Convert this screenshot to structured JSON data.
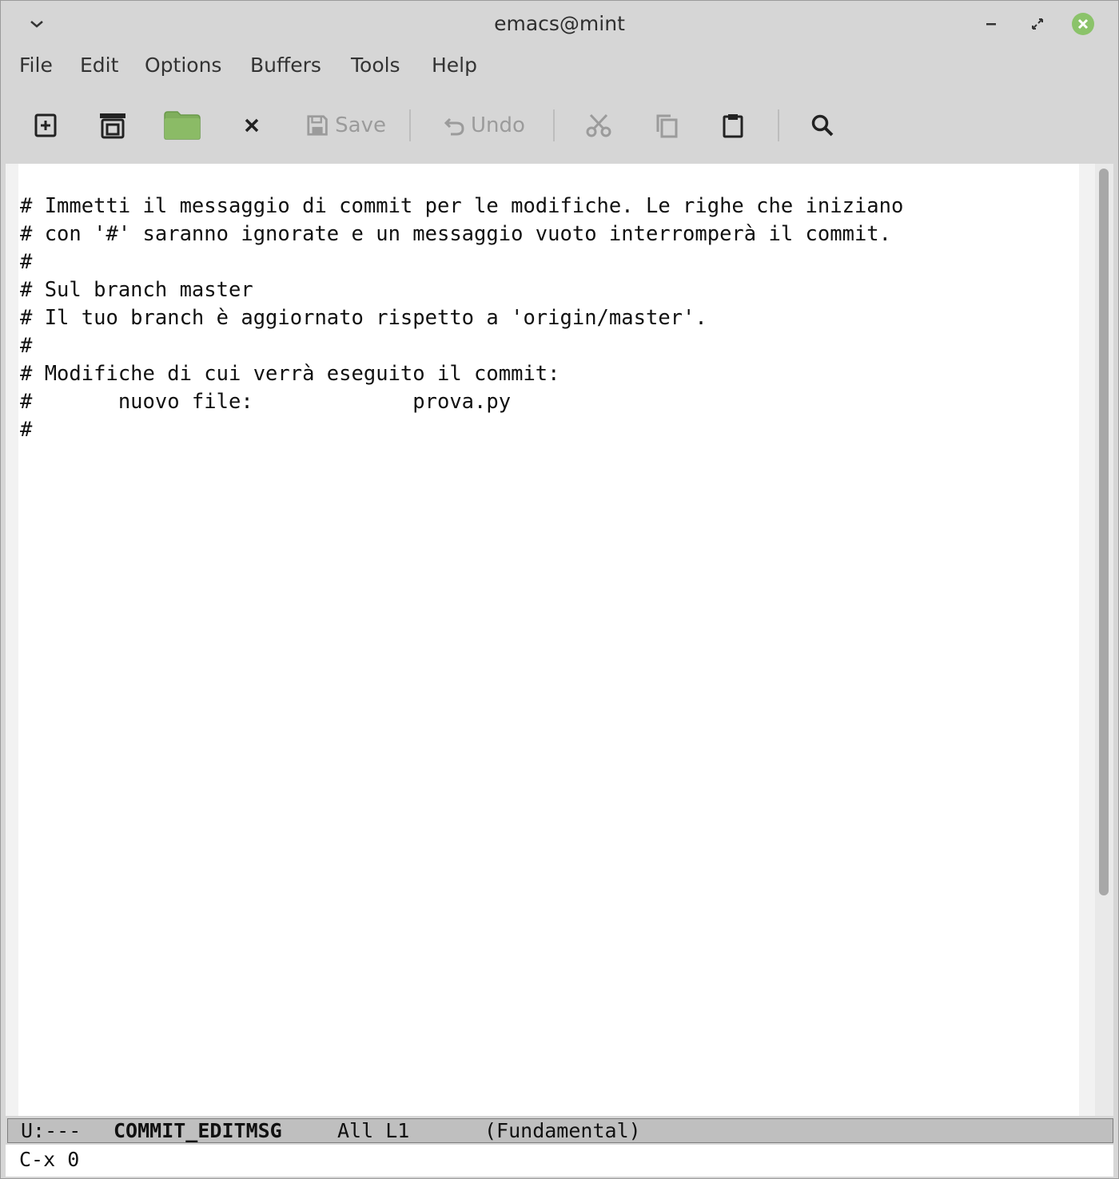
{
  "window": {
    "title": "emacs@mint"
  },
  "menubar": {
    "items": [
      "File",
      "Edit",
      "Options",
      "Buffers",
      "Tools",
      "Help"
    ]
  },
  "toolbar": {
    "save_label": "Save",
    "undo_label": "Undo",
    "icons": [
      "new-file-icon",
      "open-window-icon",
      "folder-icon",
      "close-icon",
      "save-icon",
      "undo-icon",
      "cut-icon",
      "copy-icon",
      "paste-icon",
      "search-icon"
    ]
  },
  "buffer": {
    "lines": [
      "# Immetti il messaggio di commit per le modifiche. Le righe che iniziano",
      "# con '#' saranno ignorate e un messaggio vuoto interromperà il commit.",
      "#",
      "# Sul branch master",
      "# Il tuo branch è aggiornato rispetto a 'origin/master'.",
      "#",
      "# Modifiche di cui verrà eseguito il commit:",
      "#       nuovo file:             prova.py",
      "#"
    ]
  },
  "modeline": {
    "status": "U:---",
    "buffer_name": "COMMIT_EDITMSG",
    "position": "All L1",
    "mode": "(Fundamental)"
  },
  "echo_area": {
    "text": "C-x 0"
  },
  "colors": {
    "folder": "#7fae5c",
    "close_button": "#8bc36a"
  }
}
